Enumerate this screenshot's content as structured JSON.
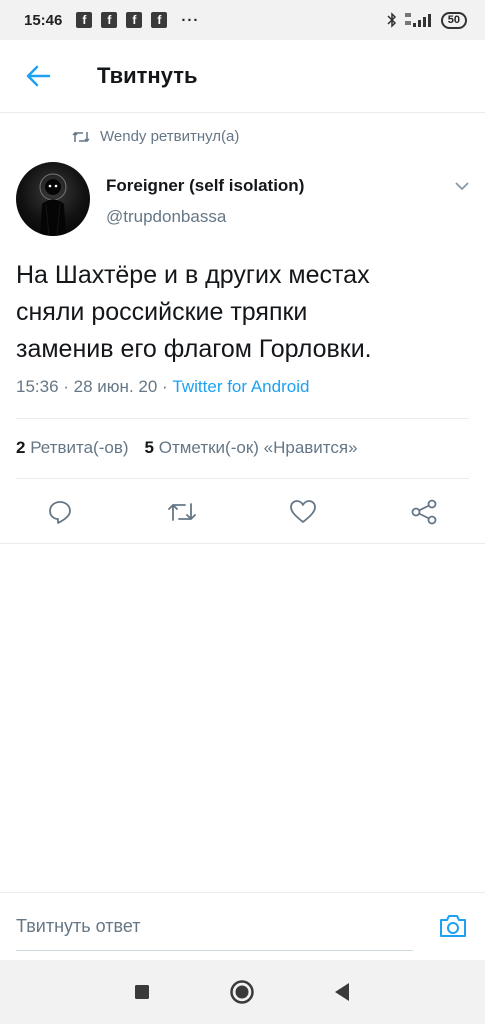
{
  "status_bar": {
    "time": "15:46",
    "app_icons": [
      "f",
      "f",
      "f",
      "f"
    ],
    "more": "···",
    "battery": "50"
  },
  "header": {
    "title": "Твитнуть"
  },
  "tweet": {
    "retweeted_by": "Wendy ретвитнул(а)",
    "author_name": "Foreigner (self isolation)",
    "author_handle": "@trupdonbassa",
    "text": "На Шахтёре и в других местах\nсняли российские тряпки\nзаменив его флагом Горловки.",
    "time": "15:36",
    "date": "28 июн. 20",
    "source": "Twitter for Android"
  },
  "stats": {
    "retweets_count": "2",
    "retweets_label": "Ретвита(-ов)",
    "likes_count": "5",
    "likes_label": "Отметки(-ок) «Нравится»"
  },
  "actions": {
    "icons": [
      "reply-icon",
      "retweet-icon",
      "like-icon",
      "share-icon"
    ]
  },
  "reply": {
    "placeholder": "Твитнуть ответ"
  },
  "colors": {
    "accent": "#1da1f2",
    "secondary_text": "#657786",
    "primary_text": "#14171a"
  }
}
